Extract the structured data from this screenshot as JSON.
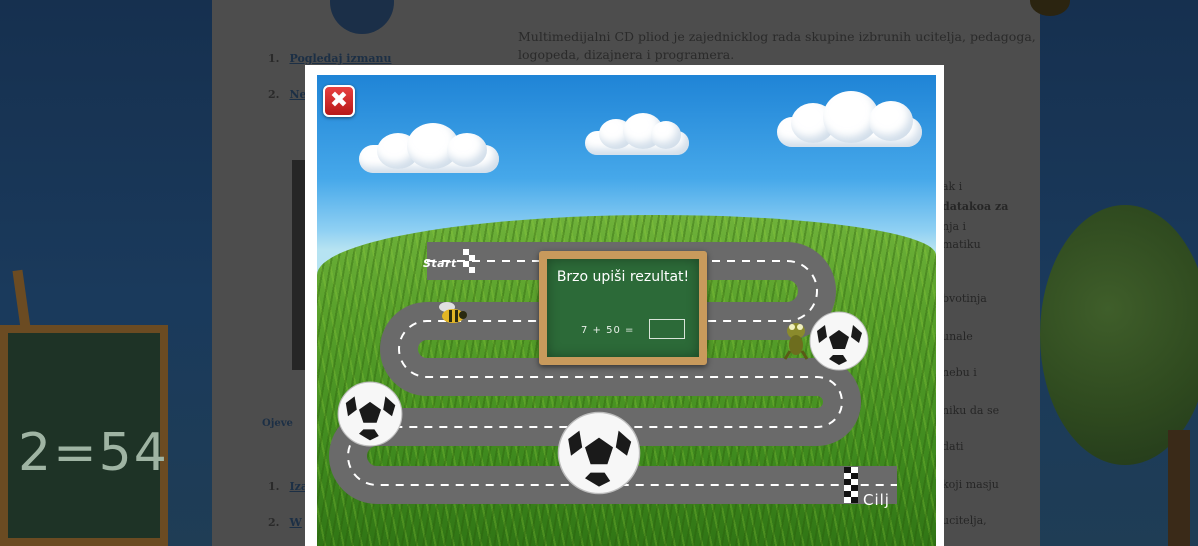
{
  "background_page": {
    "intro_text": "Multimedijalni CD pliod je zajednicklog rada skupine izbrunih ucitelja, pedagoga, logopeda, dizajnera i programera.",
    "list_items": [
      {
        "num": "1.",
        "text": "Pogledaj izmanu"
      },
      {
        "num": "2.",
        "text": "Ne"
      }
    ],
    "side_texts": [
      "ak i",
      "datakoa za",
      "nja i",
      "matiku",
      "bvotinja",
      "unale",
      "nebu i",
      "niku da se",
      "dati",
      "koji masju",
      "ucitelja,"
    ],
    "subheading": "Ojeve",
    "lower_list": [
      {
        "num": "1.",
        "text": "Iza"
      },
      {
        "num": "2.",
        "text": "W"
      }
    ],
    "chalkboard_text": "2=54"
  },
  "game": {
    "close_icon_glyph": "✖",
    "start_label": "Start",
    "finish_label": "Cilj",
    "prompt": "Brzo upiši rezultat!",
    "equation": "7 + 50 =",
    "answer_value": "",
    "answer_placeholder": ""
  },
  "colors": {
    "sky_top": "#1f84d6",
    "grass": "#58a02a",
    "road": "#6a6a6a",
    "chalkboard": "#2c6a38",
    "chalk_frame": "#c89a5c",
    "close_button": "#d32626"
  }
}
